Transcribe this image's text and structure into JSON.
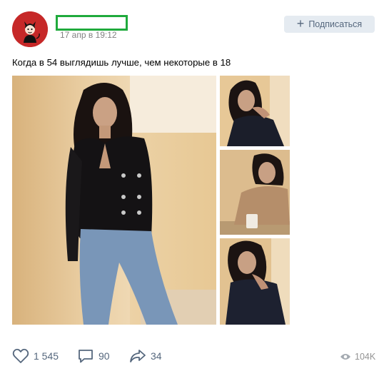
{
  "post": {
    "date": "17 апр в 19:12",
    "text": "Когда в 54 выглядишь лучше, чем некоторые в 18",
    "subscribe_label": "Подписаться"
  },
  "footer": {
    "likes": "1 545",
    "comments": "90",
    "shares": "34",
    "views": "104K"
  },
  "colors": {
    "avatar_bg": "#c62828",
    "redaction_border": "#1faa3c",
    "button_bg": "#e5ebf1",
    "icon": "#55677d"
  },
  "icons": [
    "plus-icon",
    "heart-icon",
    "comment-icon",
    "share-icon",
    "eye-icon"
  ]
}
